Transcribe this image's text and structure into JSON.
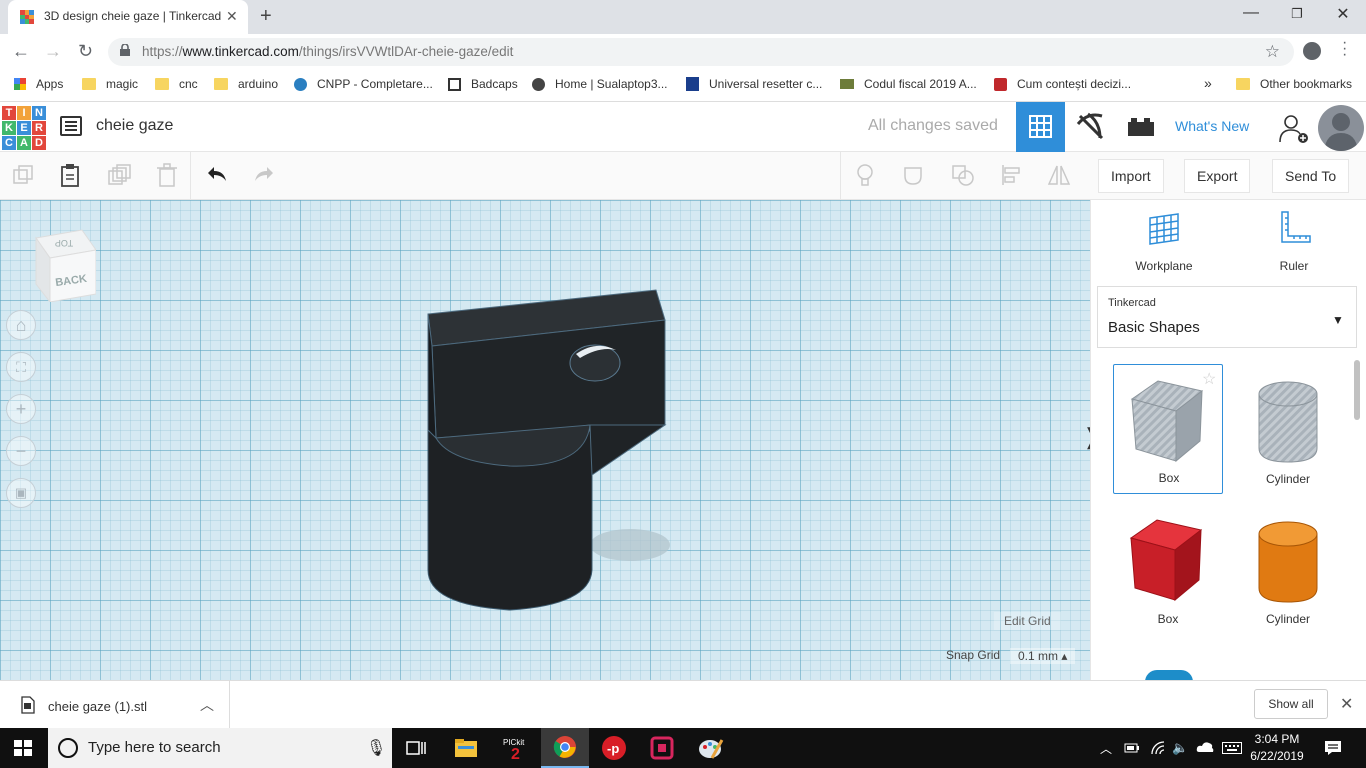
{
  "browser": {
    "tab_title": "3D design cheie gaze | Tinkercad",
    "url_prefix": "https://",
    "url_domain": "www.tinkercad.com",
    "url_path": "/things/irsVVWtlDAr-cheie-gaze/edit",
    "bookmarks": [
      {
        "label": "Apps",
        "icon": "apps-grid-icon"
      },
      {
        "label": "magic",
        "icon": "folder-icon"
      },
      {
        "label": "cnc",
        "icon": "folder-icon"
      },
      {
        "label": "arduino",
        "icon": "folder-icon"
      },
      {
        "label": "CNPP - Completare...",
        "icon": "site-icon"
      },
      {
        "label": "Badcaps",
        "icon": "site-icon"
      },
      {
        "label": "Home | Sualaptop3...",
        "icon": "globe-icon"
      },
      {
        "label": "Universal resetter c...",
        "icon": "paypal-icon"
      },
      {
        "label": "Codul fiscal 2019 A...",
        "icon": "site-icon"
      },
      {
        "label": "Cum contești decizi...",
        "icon": "site-icon"
      }
    ],
    "bookmarks_overflow": "»",
    "other_bookmarks": "Other bookmarks"
  },
  "app": {
    "logo_letters": [
      "T",
      "I",
      "N",
      "K",
      "E",
      "R",
      "C",
      "A",
      "D"
    ],
    "design_name": "cheie gaze",
    "save_status": "All changes saved",
    "whats_new": "What's New",
    "import_label": "Import",
    "export_label": "Export",
    "send_to_label": "Send To"
  },
  "workplane": {
    "viewcube_top": "TOP",
    "viewcube_back": "BACK",
    "edit_grid": "Edit Grid",
    "snap_grid_label": "Snap Grid",
    "snap_grid_value": "0.1 mm ▴",
    "expand_arrow": "❭"
  },
  "panel": {
    "workplane_label": "Workplane",
    "ruler_label": "Ruler",
    "library_sub": "Tinkercad",
    "library_title": "Basic Shapes",
    "shapes": [
      {
        "label": "Box",
        "kind": "hole-box"
      },
      {
        "label": "Cylinder",
        "kind": "hole-cylinder"
      },
      {
        "label": "Box",
        "kind": "solid-box",
        "color": "#d81e27"
      },
      {
        "label": "Cylinder",
        "kind": "solid-cylinder",
        "color": "#e87f15"
      }
    ]
  },
  "downloads": {
    "file_name": "cheie gaze (1).stl",
    "show_all": "Show all"
  },
  "taskbar": {
    "search_placeholder": "Type here to search",
    "time": "3:04 PM",
    "date": "6/22/2019",
    "apps": [
      "task-view-icon",
      "file-explorer-icon",
      "pickit-icon",
      "chrome-icon",
      "app-icon",
      "app-icon",
      "paint-icon"
    ]
  },
  "colors": {
    "accent": "#2f8ed9",
    "model": "#222629",
    "workplane": "#d5e9f2"
  }
}
